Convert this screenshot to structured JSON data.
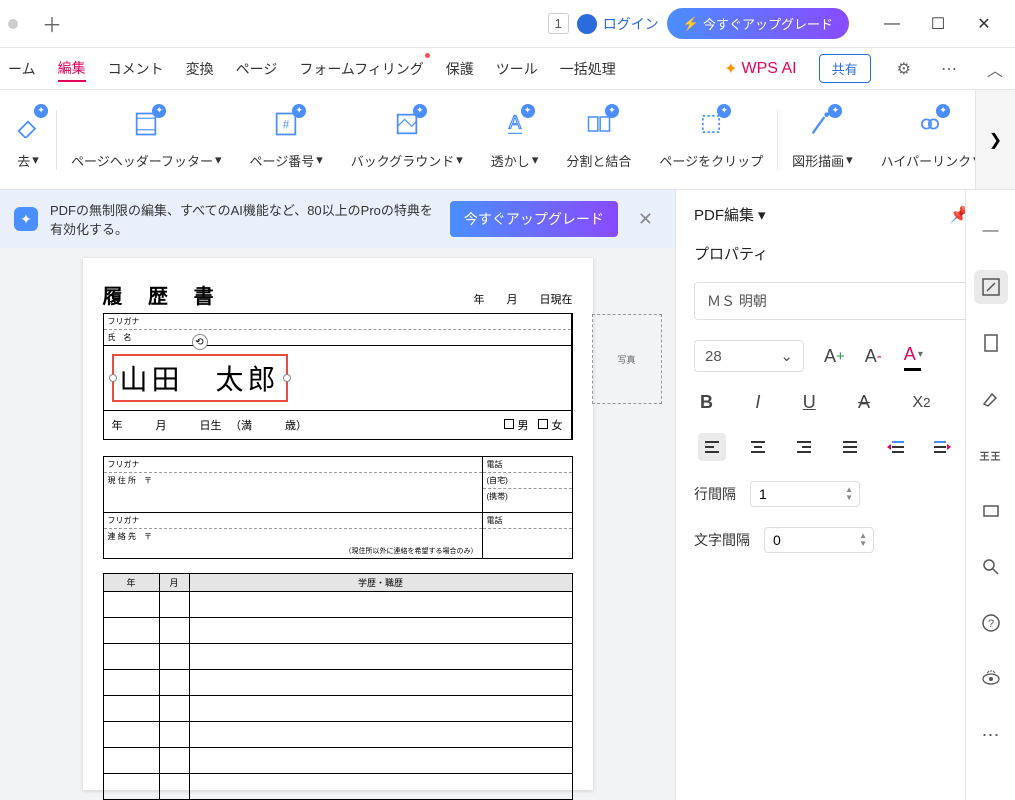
{
  "titlebar": {
    "page_indicator": "1",
    "login_label": "ログイン",
    "upgrade_label": "今すぐアップグレード"
  },
  "menu": {
    "items": [
      "ーム",
      "編集",
      "コメント",
      "変換",
      "ページ",
      "フォームフィリング",
      "保護",
      "ツール",
      "一括処理"
    ],
    "active_index": 1,
    "wps_ai": "WPS AI",
    "share": "共有"
  },
  "toolbar": {
    "items": [
      {
        "label": "去"
      },
      {
        "label": "ページヘッダーフッター"
      },
      {
        "label": "ページ番号"
      },
      {
        "label": "バックグラウンド"
      },
      {
        "label": "透かし"
      },
      {
        "label": "分割と結合"
      },
      {
        "label": "ページをクリップ"
      },
      {
        "label": "図形描画"
      },
      {
        "label": "ハイパーリンク"
      }
    ]
  },
  "banner": {
    "text": "PDFの無制限の編集、すべてのAI機能など、80以上のProの特典を有効化する。",
    "button": "今すぐアップグレード"
  },
  "resume": {
    "title": "履 歴 書",
    "date_suffix": "年　　月　　日現在",
    "furigana_label": "フリガナ",
    "name_label": "氏　名",
    "name_value": "山田　太郎",
    "photo_label": "写真",
    "birth_line": "年　　　月　　　日生 　（満　　　歳）",
    "male": "男",
    "female": "女",
    "address_label": "現 住 所　〒",
    "contact_label": "連 絡 先　〒",
    "contact_note": "（現住所以外に連絡を希望する場合のみ）",
    "phone_label": "電話",
    "phone_home": "(自宅)",
    "phone_mobile": "(携帯)",
    "history_year": "年",
    "history_month": "月",
    "history_desc": "学歴・職歴"
  },
  "panel": {
    "title": "PDF編集",
    "section": "プロパティ",
    "font_name": "ＭＳ 明朝",
    "font_size": "28",
    "line_spacing_label": "行間隔",
    "line_spacing_value": "1",
    "char_spacing_label": "文字間隔",
    "char_spacing_value": "0"
  }
}
